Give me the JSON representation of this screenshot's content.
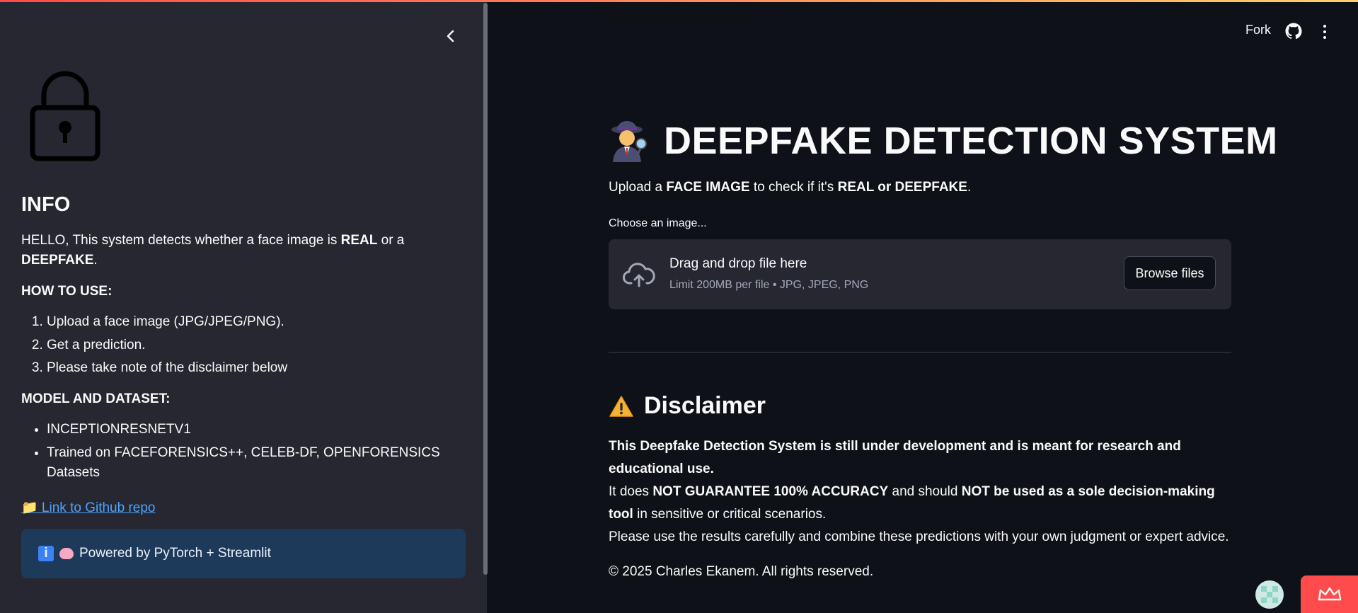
{
  "sidebar": {
    "heading": "INFO",
    "intro": {
      "pre": "HELLO, This system detects whether a face image is ",
      "real": "REAL",
      "mid": " or a ",
      "fake": "DEEPFAKE",
      "post": "."
    },
    "how_to_use_heading": "HOW TO USE:",
    "how_to_use_steps": [
      "Upload a face image (JPG/JPEG/PNG).",
      "Get a prediction.",
      "Please take note of the disclaimer below"
    ],
    "model_heading": "MODEL AND DATASET:",
    "model_items": [
      "INCEPTIONRESNETV1",
      "Trained on FACEFORENSICS++, CELEB-DF, OPENFORENSICS Datasets"
    ],
    "repo_link": "📁 Link to Github repo",
    "powered_by": "Powered by PyTorch + Streamlit"
  },
  "header": {
    "fork_label": "Fork"
  },
  "main": {
    "title": "DEEPFAKE DETECTION SYSTEM",
    "subtitle": {
      "pre": "Upload a ",
      "face": "FACE IMAGE",
      "mid": " to check if it's ",
      "verdict": "REAL or DEEPFAKE",
      "post": "."
    },
    "uploader_label": "Choose an image...",
    "drag_text": "Drag and drop file here",
    "limit_text": "Limit 200MB per file • JPG, JPEG, PNG",
    "browse_label": "Browse files",
    "disclaimer_heading": "Disclaimer",
    "disclaimer": {
      "line1": "This Deepfake Detection System is still under development and is meant for research and educational use.",
      "l2_pre": "It does ",
      "l2_b1": "NOT GUARANTEE 100% ACCURACY",
      "l2_mid": " and should ",
      "l2_b2": "NOT be used as a sole decision-making tool",
      "l2_post": " in sensitive or critical scenarios.",
      "line3": "Please use the results carefully and combine these predictions with your own judgment or expert advice."
    },
    "copyright": "© 2025 Charles Ekanem. All rights reserved."
  },
  "colors": {
    "background": "#0e1117",
    "sidebar": "#262730",
    "link": "#4fa3ff",
    "info_box": "#1e3a5a",
    "accent": "#ff4b4b"
  }
}
